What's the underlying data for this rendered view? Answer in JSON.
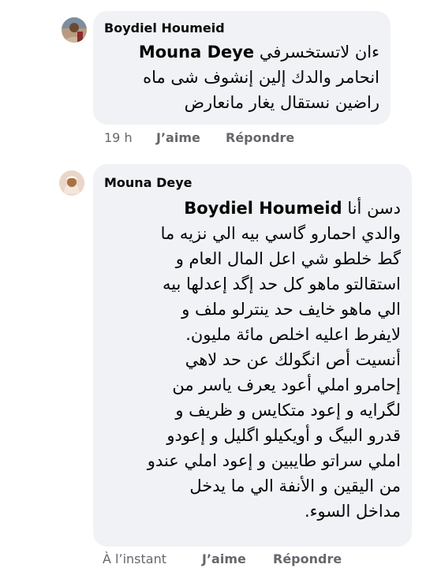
{
  "comments": [
    {
      "author": "Boydiel Houmeid",
      "mention": "Mouna Deye",
      "first_line_text": "ءان لاتستخسرفي",
      "lines": [
        "انحامر والدك إلين إنشوف شى ماه",
        "راضين نستقال يغار مانعارض"
      ],
      "time": "19 h",
      "like_label": "J’aime",
      "reply_label": "Répondre"
    },
    {
      "author": "Mouna Deye",
      "mention": "Boydiel Houmeid",
      "first_line_text": "دسن أنا",
      "lines": [
        "والدي احمارو گاسي بيه الي نزيه ما",
        "گط خلطو شي اعل المال العام و",
        "استقالتو ماهو كل حد إگد إعدلها بيه",
        "الي ماهو خايف حد ينترلو ملف و",
        "لايفرط اعليه اخلص مائة مليون.",
        "أنسيت أص انگولك عن حد لاهي",
        "إحامرو املي أعود يعرف ياسر من",
        "لگرايه و إعود متكايس و ظريف و",
        "قدرو البيگ و أويكيلو اگليل و إعودو",
        "املي سراتو طايبين و إعود املي عندو",
        "من اليقين و الأنفة الي ما يدخل",
        "مداخل السوء."
      ],
      "time": "À l’instant",
      "like_label": "J’aime",
      "reply_label": "Répondre"
    }
  ]
}
